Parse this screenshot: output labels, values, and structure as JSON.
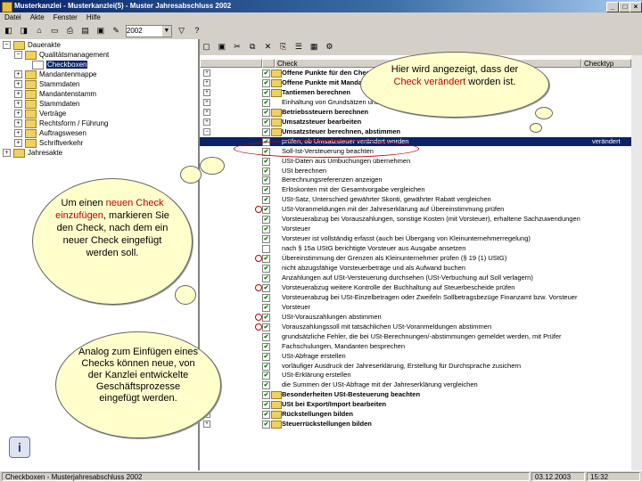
{
  "window": {
    "title": "Musterkanzlei - Musterkanzlei(5) - Muster Jahresabschluss 2002"
  },
  "menu": [
    "Datei",
    "Akte",
    "Fenster",
    "Hilfe"
  ],
  "toolbar": {
    "year": "2002"
  },
  "tree": [
    {
      "label": "Dauerakte",
      "expand": "−"
    },
    {
      "label": "Qualitätsmanagement",
      "expand": "−"
    },
    {
      "label": "Checkboxen",
      "expand": "",
      "selected": true
    },
    {
      "label": "Mandantenmappe",
      "expand": "+"
    },
    {
      "label": "Stammdaten",
      "expand": "+"
    },
    {
      "label": "Mandantenstamm",
      "expand": "+"
    },
    {
      "label": "Stammdaten",
      "expand": "+"
    },
    {
      "label": "Verträge",
      "expand": "+"
    },
    {
      "label": "Rechtsform / Führung",
      "expand": "+"
    },
    {
      "label": "Auftragswesen",
      "expand": "+"
    },
    {
      "label": "Schriftverkehr",
      "expand": "+"
    },
    {
      "label": "Jahresakte",
      "expand": "+"
    }
  ],
  "columns": {
    "check": "Check",
    "status": "Checktyp"
  },
  "rows": [
    {
      "text": "Offene Punkte für den Check",
      "bold": true,
      "plus": "+"
    },
    {
      "text": "Offene Punkte mit Mandanten",
      "bold": true,
      "plus": "+"
    },
    {
      "text": "Tantiemen berechnen",
      "bold": true,
      "plus": "+"
    },
    {
      "text": "Einhaltung von Grundsätzen und Gesetzen",
      "bold": false,
      "plus": "+"
    },
    {
      "text": "Betriebssteuern berechnen",
      "bold": true,
      "plus": "+"
    },
    {
      "text": "Umsatzsteuer bearbeiten",
      "bold": true,
      "plus": "+"
    },
    {
      "text": "Umsatzsteuer berechnen, abstimmen",
      "bold": true,
      "plus": "−"
    },
    {
      "text": "prüfen, ob Umsatzsteuer verändert worden",
      "bold": false,
      "plus": "",
      "selected": true,
      "status": "verändert"
    },
    {
      "text": "Soll-Ist-Versteuerung beachten",
      "bold": false
    },
    {
      "text": "USt-Daten aus Umbuchungen übernehmen",
      "bold": false
    },
    {
      "text": "USt berechnen",
      "bold": false
    },
    {
      "text": "Berechnungsreferenzen anzeigen",
      "bold": false
    },
    {
      "text": "Erlöskonten mit der Gesamtvorgabe vergleichen",
      "bold": false
    },
    {
      "text": "USt-Satz, Unterschied gewährter Skonti, gewährter Rabatt vergleichen",
      "bold": false
    },
    {
      "text": "USt-Voranmeldungen mit der Jahreserklärung auf Übereinstimmung prüfen",
      "bold": false,
      "circle": true
    },
    {
      "text": "Vorsteuerabzug bei Vorauszahlungen, sonstige Kosten (mit Vorsteuer), erhaltene Sachzuwendungen",
      "bold": false
    },
    {
      "text": "Vorsteuer",
      "bold": false
    },
    {
      "text": "Vorsteuer ist vollständig erfasst (auch bei Übergang von Kleinunternehmerregelung)",
      "bold": false
    },
    {
      "text": "nach § 15a UStG berichtigte Vorsteuer aus Ausgabe ansetzen",
      "bold": false,
      "unchecked": true
    },
    {
      "text": "Übereinstimmung der Grenzen als Kleinunternehmer prüfen (§ 19 (1) UStG)",
      "bold": false,
      "circle": true
    },
    {
      "text": "nicht abzugsfähige Vorsteuerbeträge und als Aufwand buchen",
      "bold": false
    },
    {
      "text": "Anzahlungen auf USt-Versteuerung durchsehen (USt-Verbuchung auf Soll verlagern)",
      "bold": false
    },
    {
      "text": "Vorsteuerabzug weitere Kontrolle der Buchhaltung auf Steuerbescheide prüfen",
      "bold": false,
      "circle": true
    },
    {
      "text": "Vorsteuerabzug bei USt-Einzelbetragen oder Zweifeln Sollbetragsbezüge Finanzamt bzw. Vorsteuer",
      "bold": false
    },
    {
      "text": "Vorsteuer",
      "bold": false
    },
    {
      "text": "USt-Vorauszahlungen abstimmen",
      "bold": false,
      "circle": true
    },
    {
      "text": "Vorauszahlungssoll mit tatsächlichen USt-Voranmeldungen abstimmen",
      "bold": false,
      "circle": true
    },
    {
      "text": "grundsätzliche Fehler, die bei USt-Berechnungen/-abstimmungen gemeldet werden, mit Prüfer",
      "bold": false
    },
    {
      "text": "Fachschulungen, Mandanten besprechen",
      "bold": false
    },
    {
      "text": "USt-Abfrage erstellen",
      "bold": false
    },
    {
      "text": "vorläufiger Ausdruck der Jahreserklärung, Erstellung für Durchsprache zusichern",
      "bold": false
    },
    {
      "text": "USt-Erklärung erstellen",
      "bold": false
    },
    {
      "text": "die Summen der USt-Abfrage mit der Jahreserklärung vergleichen",
      "bold": false
    },
    {
      "text": "Besonderheiten USt-Besteuerung beachten",
      "bold": true,
      "plus": "+"
    },
    {
      "text": "USt bei Export/Import bearbeiten",
      "bold": true,
      "plus": "+"
    },
    {
      "text": "Rückstellungen bilden",
      "bold": true,
      "plus": "+"
    },
    {
      "text": "Steuerrückstellungen bilden",
      "bold": true,
      "plus": "+"
    }
  ],
  "statusbar": {
    "left": "Checkboxen - Musterjahresabschluss 2002",
    "date": "03.12.2003",
    "time": "15:32"
  },
  "callouts": {
    "top_pre": "Hier wird angezeigt, dass der",
    "top_red": "Check verändert",
    "top_post": "worden ist.",
    "mid_pre": "Um einen",
    "mid_red": "neuen Check einzufügen",
    "mid_post": ", markieren Sie den Check, nach dem ein neuer Check eingefügt werden soll.",
    "low": "Analog zum Einfügen eines Checks können neue, von der Kanzlei entwickelte Geschäftsprozesse eingefügt werden."
  },
  "colors": {
    "accent": "#0a246a",
    "highlight": "#c00000",
    "cloud": "#ffffcc"
  }
}
